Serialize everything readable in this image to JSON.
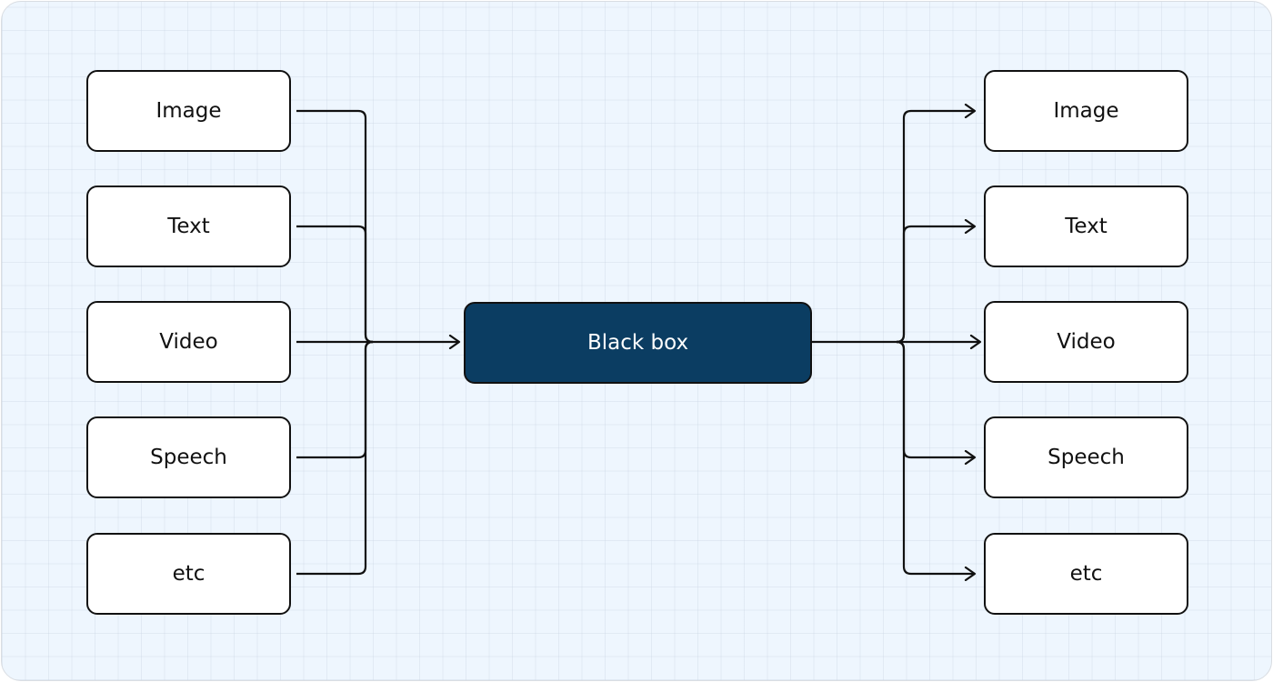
{
  "inputs": [
    "Image",
    "Text",
    "Video",
    "Speech",
    "etc"
  ],
  "center": {
    "label": "Black box",
    "fill": "#0b3d62"
  },
  "outputs": [
    "Image",
    "Text",
    "Video",
    "Speech",
    "etc"
  ],
  "colors": {
    "background": "#eef6fe",
    "stroke": "#111111",
    "box": "#ffffff"
  }
}
